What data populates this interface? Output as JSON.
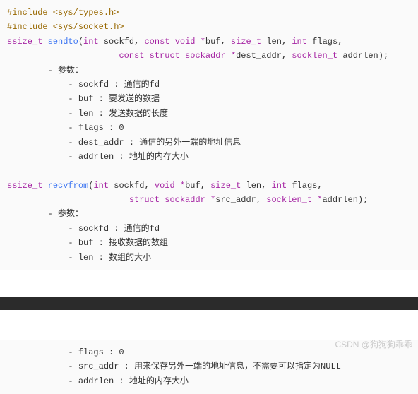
{
  "block1": {
    "line1_inc1": "#include <sys/types.h>",
    "line2_inc2": "#include <sys/socket.h>",
    "sendto_sig1_ret": "ssize_t",
    "sendto_sig1_fn": "sendto",
    "sendto_sig1_p1_t": "int",
    "sendto_sig1_p1_n": "sockfd",
    "sendto_sig1_p2_t": "const void *",
    "sendto_sig1_p2_n": "buf",
    "sendto_sig1_p3_t": "size_t",
    "sendto_sig1_p3_n": "len",
    "sendto_sig1_p4_t": "int",
    "sendto_sig1_p4_n": "flags",
    "sendto_sig2_p5_t": "const struct sockaddr *",
    "sendto_sig2_p5_n": "dest_addr",
    "sendto_sig2_p6_t": "socklen_t",
    "sendto_sig2_p6_n": "addrlen",
    "param_header": "- 参数：",
    "sendto_p1": "- sockfd : 通信的fd",
    "sendto_p2": "- buf : 要发送的数据",
    "sendto_p3": "- len : 发送数据的长度",
    "sendto_p4": "- flags : 0",
    "sendto_p5": "- dest_addr : 通信的另外一端的地址信息",
    "sendto_p6": "- addrlen : 地址的内存大小",
    "recvfrom_sig1_ret": "ssize_t",
    "recvfrom_sig1_fn": "recvfrom",
    "recvfrom_sig1_p1_t": "int",
    "recvfrom_sig1_p1_n": "sockfd",
    "recvfrom_sig1_p2_t": "void *",
    "recvfrom_sig1_p2_n": "buf",
    "recvfrom_sig1_p3_t": "size_t",
    "recvfrom_sig1_p3_n": "len",
    "recvfrom_sig1_p4_t": "int",
    "recvfrom_sig1_p4_n": "flags",
    "recvfrom_sig2_p5_t": "struct sockaddr *",
    "recvfrom_sig2_p5_n": "src_addr",
    "recvfrom_sig2_p6_t": "socklen_t *",
    "recvfrom_sig2_p6_n": "addrlen",
    "recvfrom_p1": "- sockfd : 通信的fd",
    "recvfrom_p2": "- buf : 接收数据的数组",
    "recvfrom_p3": "- len : 数组的大小"
  },
  "block2": {
    "p1": "- flags : 0",
    "p2": "- src_addr : 用来保存另外一端的地址信息，不需要可以指定为NULL",
    "p3": "- addrlen : 地址的内存大小"
  },
  "watermark": "CSDN @狗狗狗乖乖"
}
